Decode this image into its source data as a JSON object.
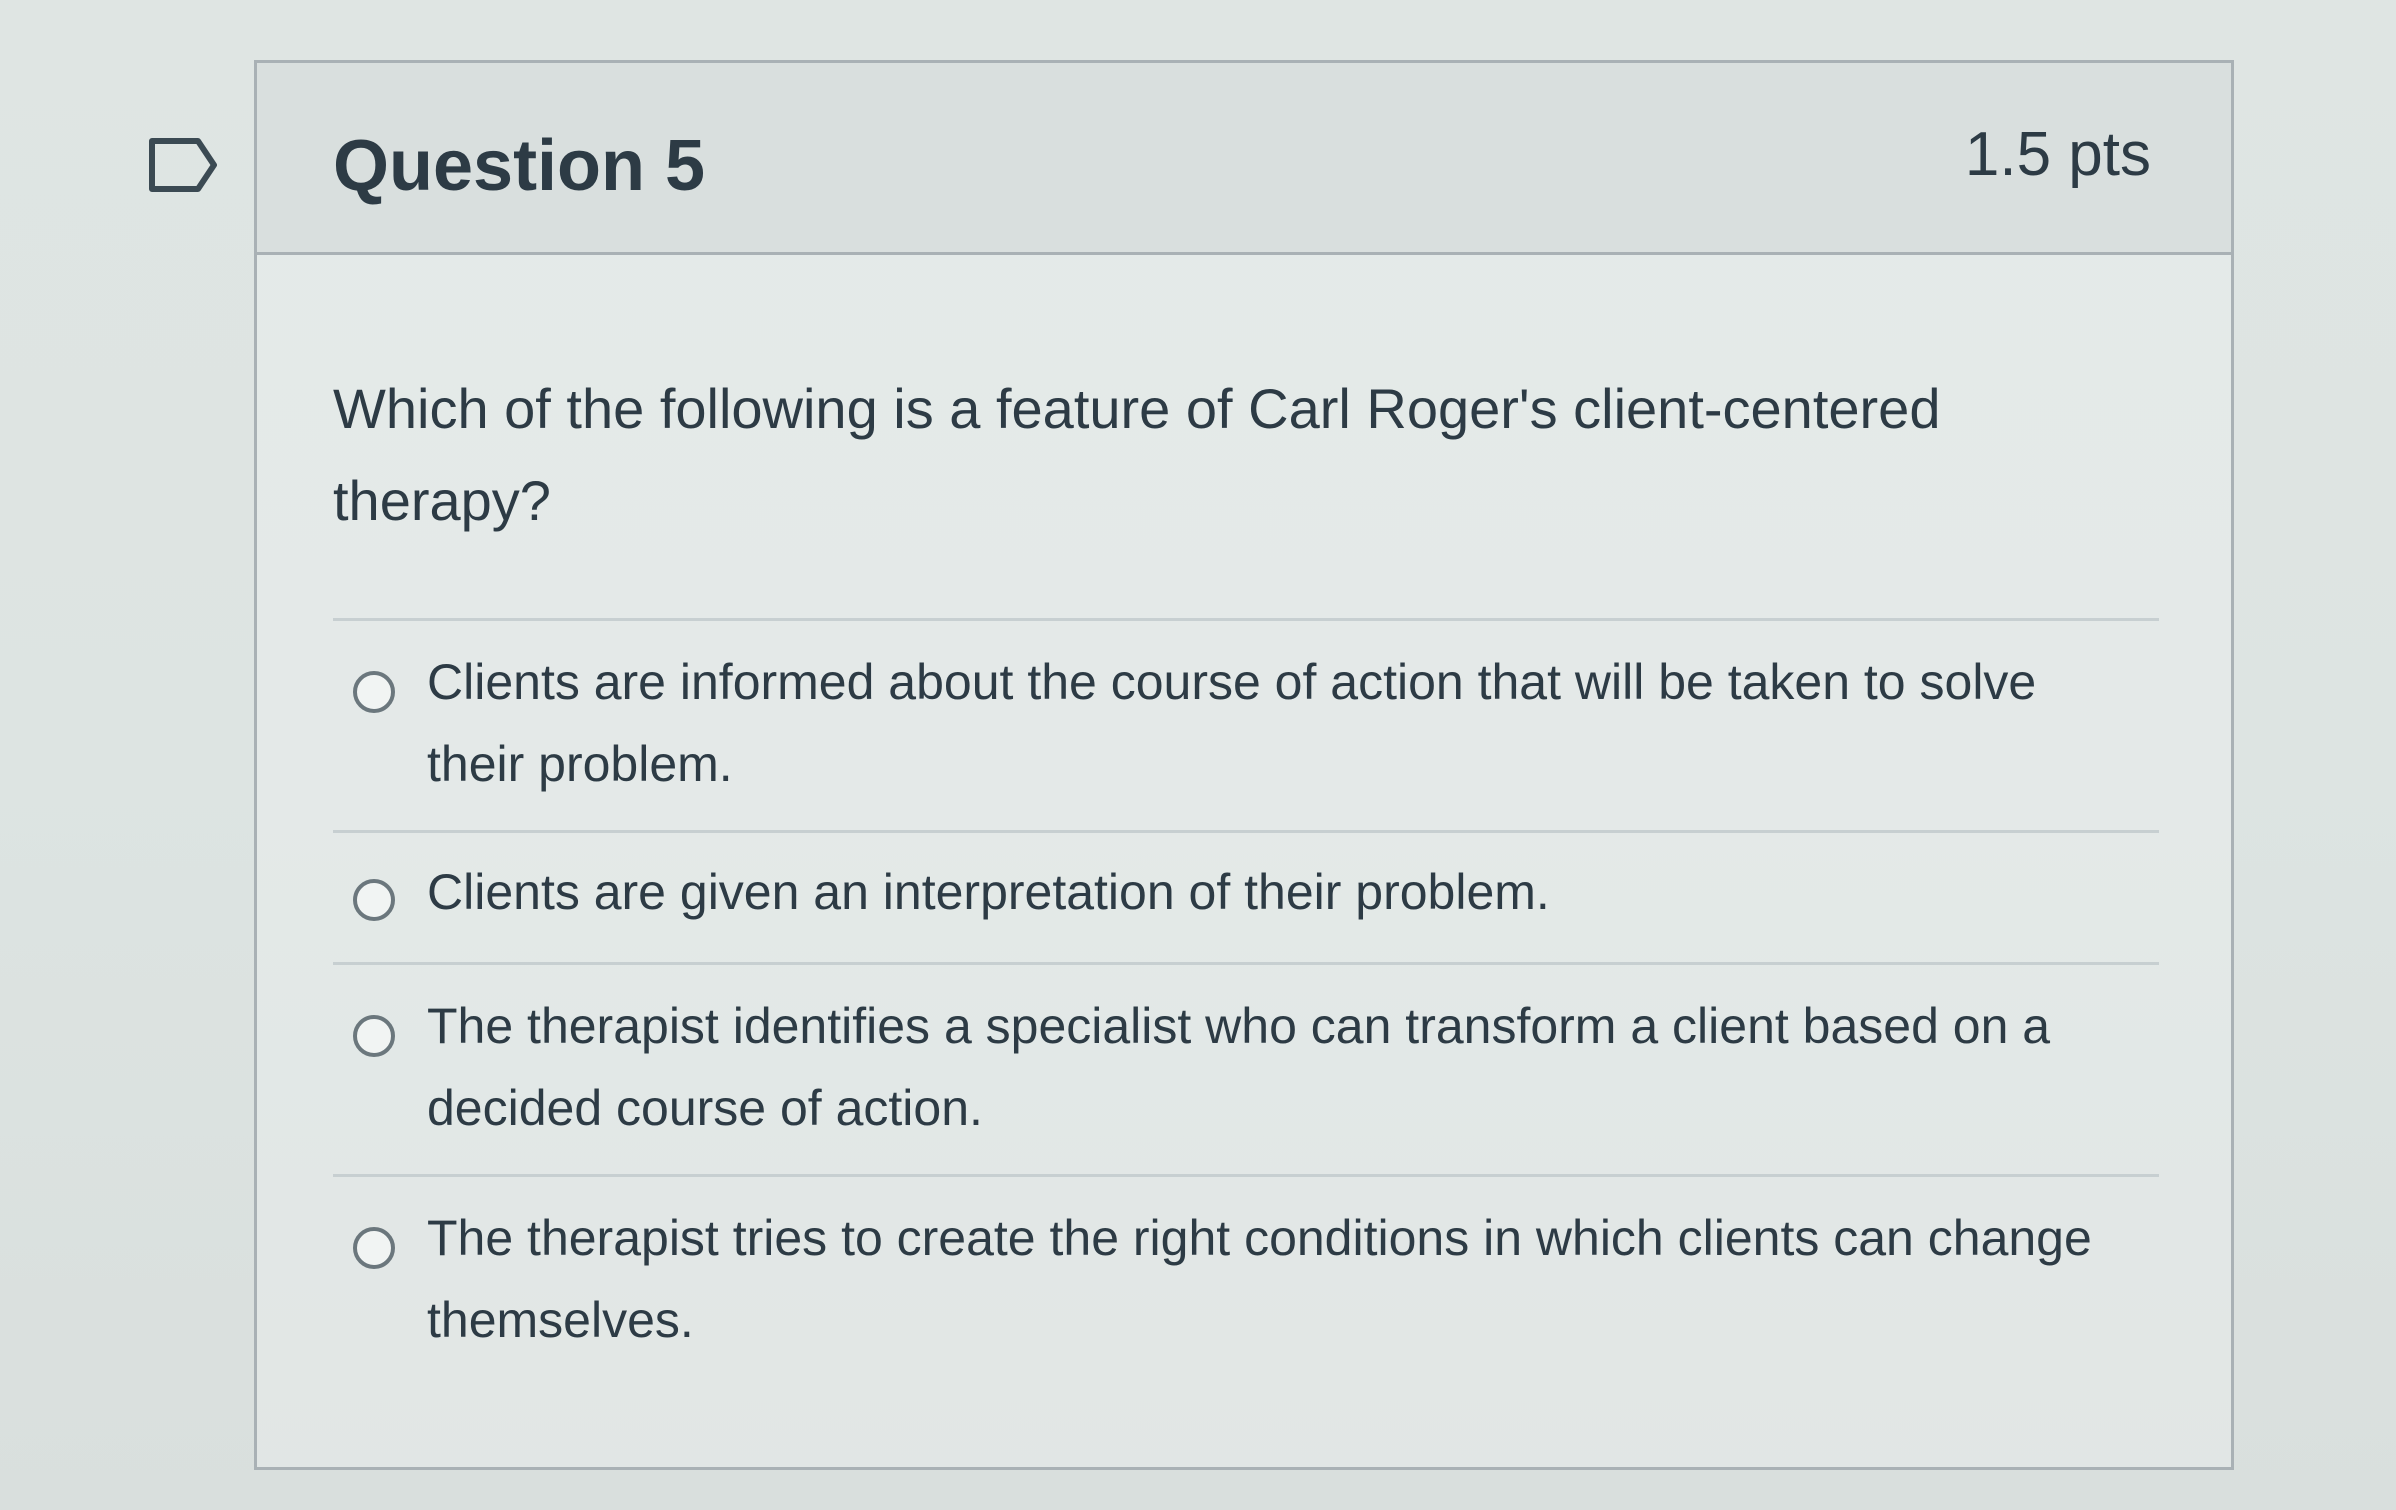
{
  "question": {
    "title": "Question 5",
    "points": "1.5 pts",
    "text": "Which of the following is a feature of Carl Roger's client-centered therapy?",
    "flag_icon": "bookmark-flag-icon",
    "answers": [
      {
        "label": "Clients are informed about the course of action that will be taken to solve their problem."
      },
      {
        "label": "Clients are given an interpretation of their problem."
      },
      {
        "label": "The therapist identifies a specialist who can transform a client based on a decided course of action."
      },
      {
        "label": "The therapist tries to create the right conditions in which clients can change themselves."
      }
    ]
  },
  "colors": {
    "text": "#2d3b45",
    "border": "#a9b1b5",
    "header_background": "#d7dddc",
    "divider": "#c7cfd1"
  }
}
